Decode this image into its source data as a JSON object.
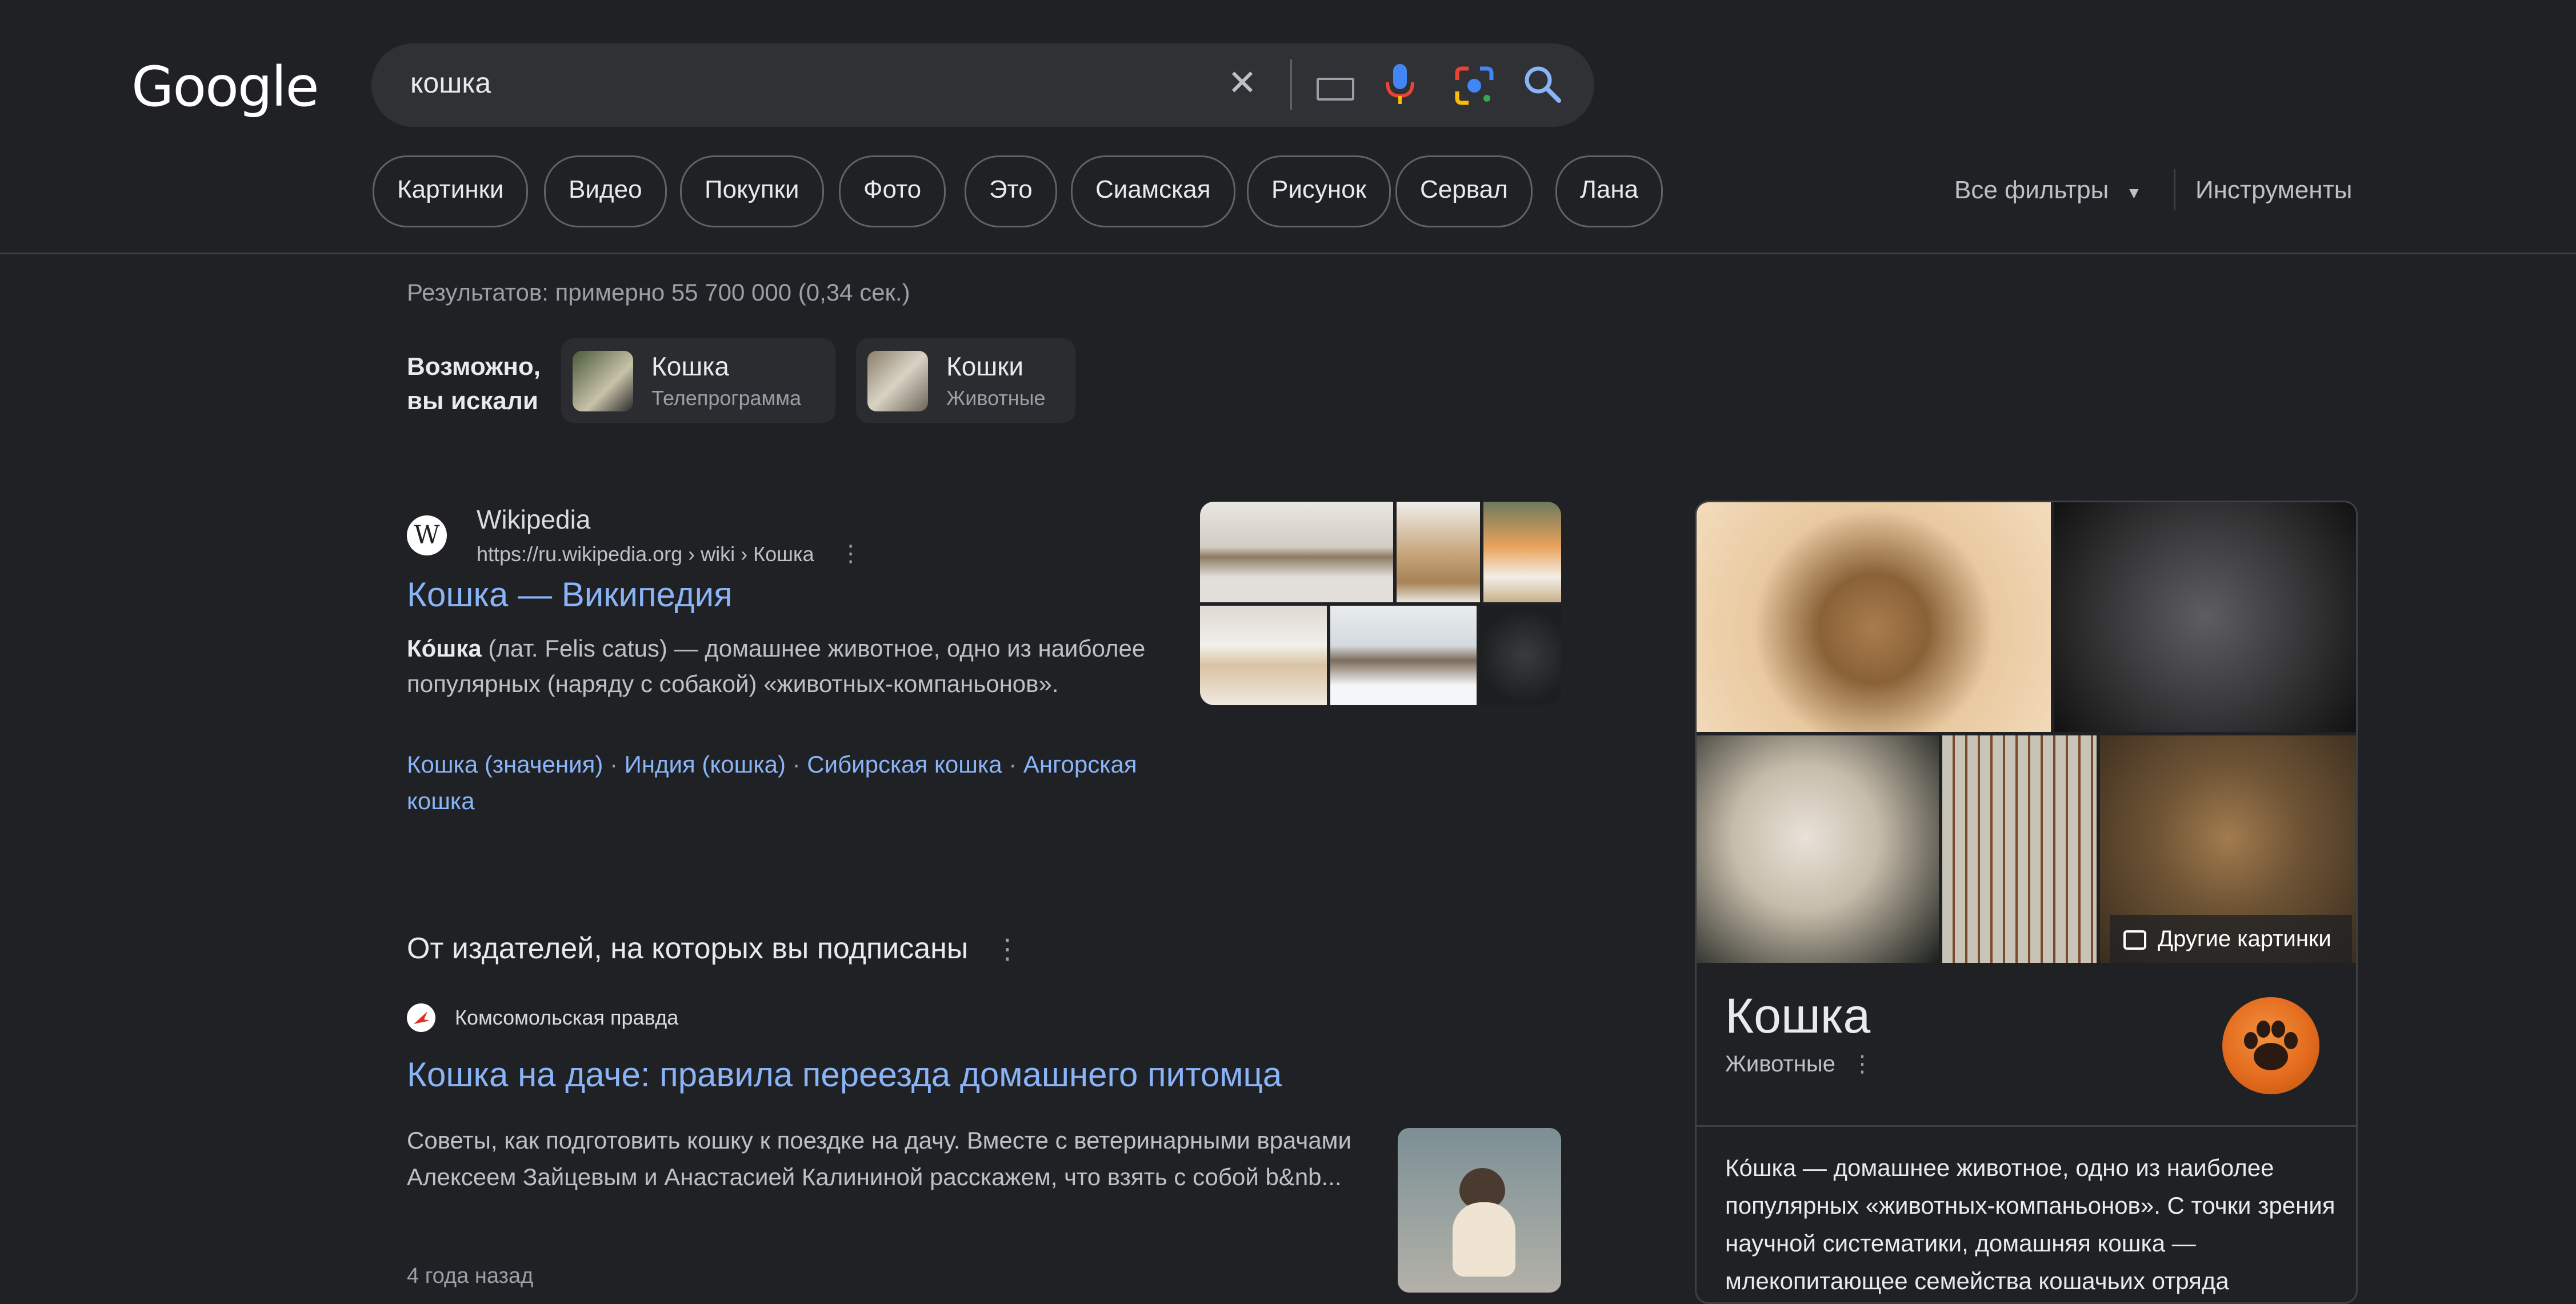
{
  "header": {
    "logo": "Google",
    "query": "кошка",
    "icons": [
      "clear-icon",
      "keyboard-icon",
      "mic-icon",
      "lens-icon",
      "search-icon"
    ]
  },
  "chips": [
    "Картинки",
    "Видео",
    "Покупки",
    "Фото",
    "Это",
    "Сиамская",
    "Рисунок",
    "Сервал",
    "Лана"
  ],
  "toolbar": {
    "all_filters": "Все фильтры",
    "tools": "Инструменты"
  },
  "stats": "Результатов: примерно 55 700 000 (0,34 сек.)",
  "maybe": {
    "line1": "Возможно,",
    "line2": "вы искали",
    "items": [
      {
        "title": "Кошка",
        "subtitle": "Телепрограмма"
      },
      {
        "title": "Кошки",
        "subtitle": "Животные"
      }
    ]
  },
  "result1": {
    "site": "Wikipedia",
    "url": "https://ru.wikipedia.org › wiki › Кошка",
    "title": "Кошка — Википедия",
    "snippet_bold": "Ко́шка",
    "snippet_rest": " (лат. Felis catus) — домашнее животное, одно из наиболее популярных (наряду с собакой) «животных-компаньонов».",
    "links": [
      "Кошка (значения)",
      "Индия (кошка)",
      "Сибирская кошка",
      "Ангорская кошка"
    ],
    "link_sep": " · "
  },
  "publishers": {
    "heading": "От издателей, на которых вы подписаны",
    "source": "Комсомольская правда",
    "title": "Кошка на даче: правила переезда домашнего питомца",
    "snippet": "Советы, как подготовить кошку к поездке на дачу. Вместе с ветеринарными врачами Алексеем Зайцевым и Анастасией Калининой расскажем, что взять с собой b&nb...",
    "date": "4 года назад"
  },
  "panel": {
    "more_images": "Другие картинки",
    "title": "Кошка",
    "subtitle": "Животные",
    "description": "Ко́шка — домашнее животное, одно из наиболее популярных «животных-компаньонов». С точки зрения научной систематики, домашняя кошка — млекопитающее семейства кошачьих отряда"
  },
  "colors": {
    "background": "#202124",
    "link": "#8ab4f8",
    "text": "#e8eaed",
    "muted": "#9aa0a6",
    "accent_orange": "#e46b1e"
  }
}
